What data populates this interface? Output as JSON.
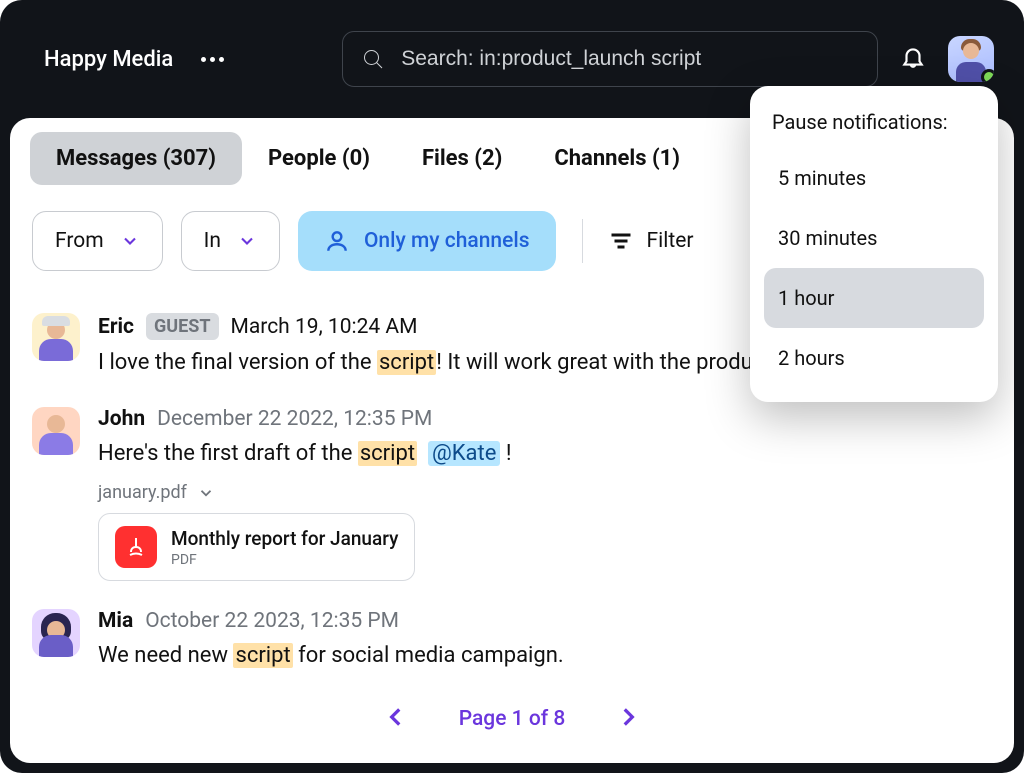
{
  "workspace": {
    "name": "Happy Media"
  },
  "search": {
    "value": "Search: in:product_launch script"
  },
  "tabs": [
    {
      "label": "Messages (307)",
      "active": true
    },
    {
      "label": "People (0)",
      "active": false
    },
    {
      "label": "Files (2)",
      "active": false
    },
    {
      "label": "Channels (1)",
      "active": false
    }
  ],
  "filters": {
    "from_label": "From",
    "in_label": "In",
    "only_my_channels": "Only my channels",
    "filter_label": "Filter"
  },
  "messages": [
    {
      "author": "Eric",
      "guest": "GUEST",
      "date": "March 19, 10:24 AM",
      "text_before": "I love the final version of the ",
      "highlight": "script",
      "text_after": "! It will work great with the produc"
    },
    {
      "author": "John",
      "date": "December 22 2022, 12:35 PM",
      "text_before": "Here's the first draft of the ",
      "highlight": "script",
      "mention": "@Kate",
      "text_after": " !",
      "attachment_label": "january.pdf",
      "file_title": "Monthly report for January",
      "file_type": "PDF"
    },
    {
      "author": "Mia",
      "date": "October 22 2023, 12:35 PM",
      "text_before": "We need new ",
      "highlight": "script",
      "text_after": " for social media campaign."
    }
  ],
  "pager": {
    "label": "Page 1 of 8"
  },
  "notifications_popover": {
    "title": "Pause notifications:",
    "options": [
      {
        "label": "5 minutes",
        "selected": false
      },
      {
        "label": "30 minutes",
        "selected": false
      },
      {
        "label": "1 hour",
        "selected": true
      },
      {
        "label": "2 hours",
        "selected": false
      }
    ]
  }
}
